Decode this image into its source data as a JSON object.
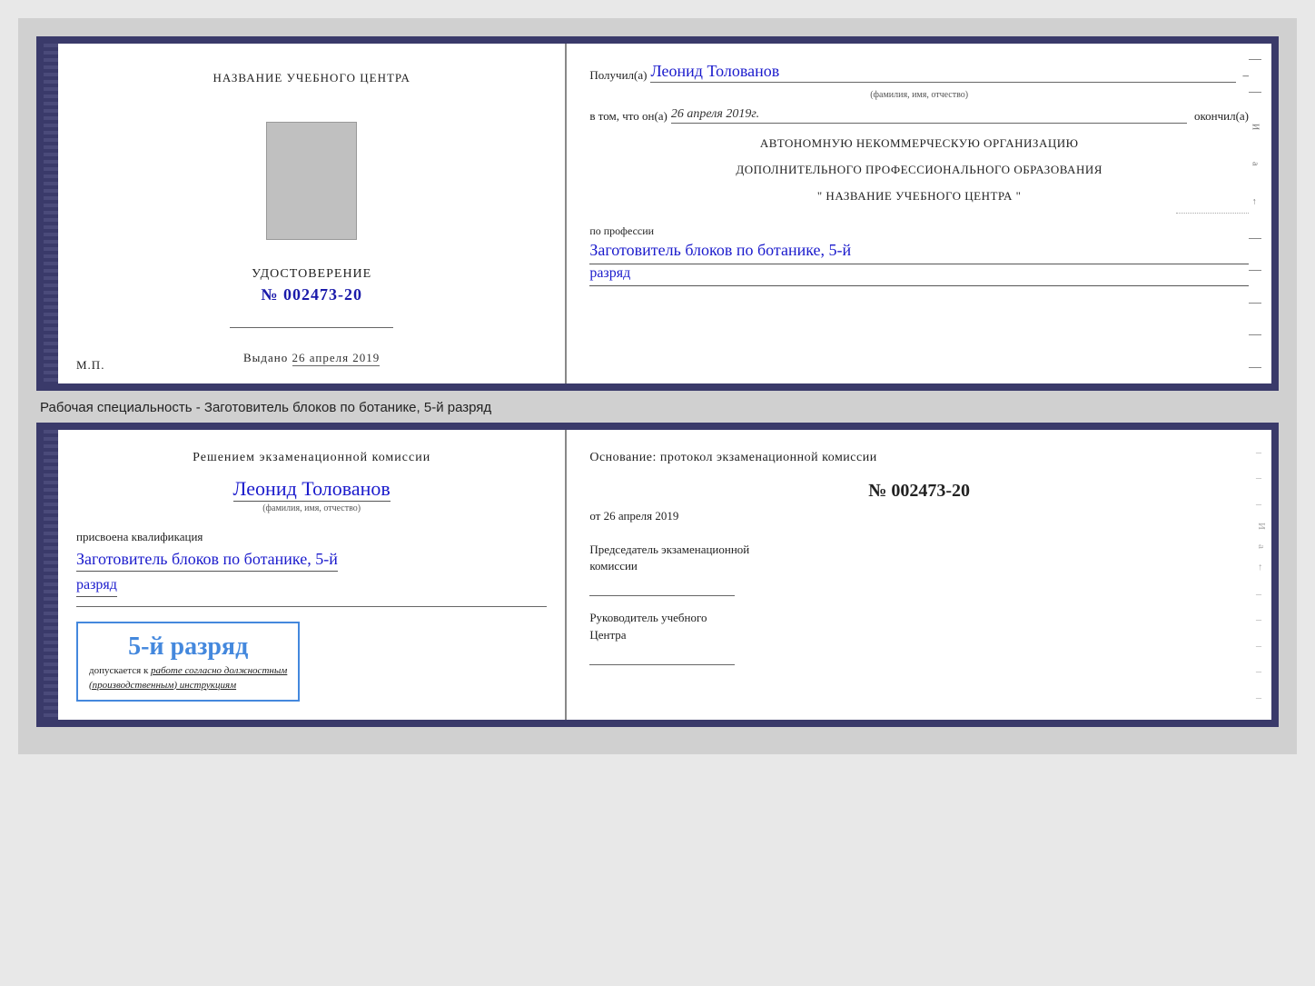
{
  "top_doc": {
    "left": {
      "center_title": "НАЗВАНИЕ УЧЕБНОГО ЦЕНТРА",
      "cert_label": "УДОСТОВЕРЕНИЕ",
      "cert_number": "№ 002473-20",
      "issued_label": "Выдано",
      "issued_date": "26 апреля 2019",
      "mp_label": "М.П."
    },
    "right": {
      "received_label": "Получил(а)",
      "person_name": "Леонид Толованов",
      "name_sub": "(фамилия, имя, отчество)",
      "dash": "–",
      "in_that_label": "в том, что он(а)",
      "date_finished": "26 апреля 2019г.",
      "finished_label": "окончил(а)",
      "org_line1": "АВТОНОМНУЮ НЕКОММЕРЧЕСКУЮ ОРГАНИЗАЦИЮ",
      "org_line2": "ДОПОЛНИТЕЛЬНОГО ПРОФЕССИОНАЛЬНОГО ОБРАЗОВАНИЯ",
      "org_line3": "\"   НАЗВАНИЕ УЧЕБНОГО ЦЕНТРА   \"",
      "profession_label": "по профессии",
      "profession_value": "Заготовитель блоков по ботанике, 5-й",
      "rank_value": "разряд"
    }
  },
  "subtitle": "Рабочая специальность - Заготовитель блоков по ботанике, 5-й разряд",
  "bottom_doc": {
    "left": {
      "decision_label": "Решением экзаменационной комиссии",
      "person_name": "Леонид Толованов",
      "name_sub": "(фамилия, имя, отчество)",
      "assigned_label": "присвоена квалификация",
      "qual_line1": "Заготовитель блоков по ботанике, 5-й",
      "qual_line2": "разряд",
      "stamp_rank": "5-й разряд",
      "stamp_admit": "допускается к",
      "stamp_italic": "работе согласно должностным",
      "stamp_italic2": "(производственным) инструкциям"
    },
    "right": {
      "basis_label": "Основание: протокол экзаменационной комиссии",
      "protocol_num": "№  002473-20",
      "date_from_label": "от",
      "date_from_value": "26 апреля 2019",
      "chairman_label": "Председатель экзаменационной",
      "chairman_label2": "комиссии",
      "head_label": "Руководитель учебного",
      "head_label2": "Центра"
    }
  }
}
